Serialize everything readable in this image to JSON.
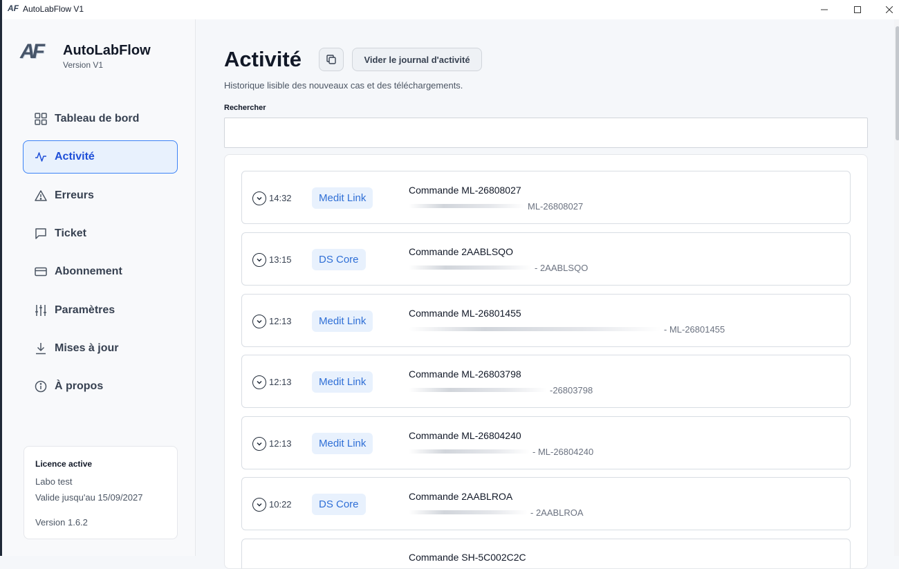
{
  "window": {
    "title": "AutoLabFlow V1",
    "icon_text": "AF"
  },
  "brand": {
    "name": "AutoLabFlow",
    "version": "Version V1",
    "logo_text": "AF"
  },
  "sidebar": {
    "items": [
      {
        "label": "Tableau de bord",
        "icon": "dashboard-grid-icon",
        "active": false
      },
      {
        "label": "Activité",
        "icon": "activity-pulse-icon",
        "active": true
      },
      {
        "label": "Erreurs",
        "icon": "warning-triangle-icon",
        "active": false
      },
      {
        "label": "Ticket",
        "icon": "message-icon",
        "active": false
      },
      {
        "label": "Abonnement",
        "icon": "credit-card-icon",
        "active": false
      },
      {
        "label": "Paramètres",
        "icon": "sliders-icon",
        "active": false
      },
      {
        "label": "Mises à jour",
        "icon": "download-icon",
        "active": false
      },
      {
        "label": "À propos",
        "icon": "info-icon",
        "active": false
      }
    ]
  },
  "license": {
    "title": "Licence active",
    "lab": "Labo test",
    "valid_until": "Valide jusqu'au 15/09/2027",
    "version": "Version 1.6.2"
  },
  "main": {
    "title": "Activité",
    "clear_button": "Vider le journal d'activité",
    "subtitle": "Historique lisible des nouveaux cas et des téléchargements.",
    "search_label": "Rechercher",
    "search_value": ""
  },
  "entries": [
    {
      "time": "14:32",
      "source": "Medit Link",
      "command": "Commande ML-26808027",
      "detail_suffix": "ML-26808027"
    },
    {
      "time": "13:15",
      "source": "DS Core",
      "command": "Commande 2AABLSQO",
      "detail_suffix": "- 2AABLSQO"
    },
    {
      "time": "12:13",
      "source": "Medit Link",
      "command": "Commande ML-26801455",
      "detail_suffix": "- ML-26801455"
    },
    {
      "time": "12:13",
      "source": "Medit Link",
      "command": "Commande ML-26803798",
      "detail_suffix": "-26803798"
    },
    {
      "time": "12:13",
      "source": "Medit Link",
      "command": "Commande ML-26804240",
      "detail_suffix": "- ML-26804240"
    },
    {
      "time": "10:22",
      "source": "DS Core",
      "command": "Commande 2AABLROA",
      "detail_suffix": "- 2AABLROA"
    },
    {
      "time": "",
      "source": "",
      "command": "Commande SH-5C002C2C",
      "detail_suffix": ""
    }
  ],
  "colors": {
    "accent": "#3b82f6",
    "badge_bg": "#e8f1fd",
    "badge_text": "#2f6fd6"
  }
}
